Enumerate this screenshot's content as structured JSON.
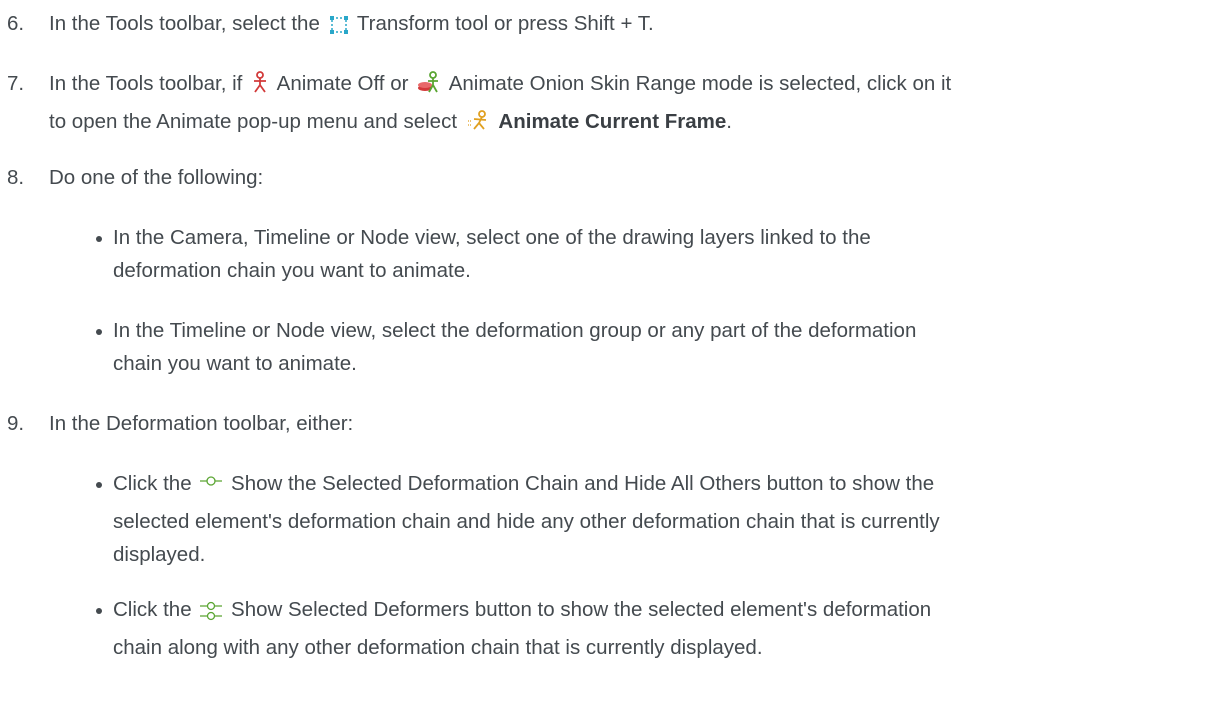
{
  "step6": {
    "num": "6.",
    "pre": "In the Tools toolbar, select the",
    "post": "Transform tool or press Shift + T."
  },
  "step7": {
    "num": "7.",
    "a": "In the Tools toolbar, if",
    "b": "Animate Off or",
    "c": "Animate Onion Skin Range mode is selected, click on it",
    "d": "to open the Animate pop-up menu and select",
    "bold": "Animate Current Frame",
    "end": "."
  },
  "step8": {
    "num": "8.",
    "text": "Do one of the following:",
    "bullet1_line1": "In the Camera, Timeline or Node view, select one of the drawing layers linked to the",
    "bullet1_line2": "deformation chain you want to animate.",
    "bullet2_line1": "In the Timeline or Node view, select the deformation group or any part of the deformation",
    "bullet2_line2": "chain you want to animate."
  },
  "step9": {
    "num": "9.",
    "text": "In the Deformation toolbar, either:",
    "bullet1_pre": "Click the",
    "bullet1_line1": "Show the Selected Deformation Chain and Hide All Others button to show the",
    "bullet1_line2": "selected element's deformation chain and hide any other deformation chain that is currently",
    "bullet1_line3": "displayed.",
    "bullet2_pre": "Click the",
    "bullet2_line1": "Show Selected Deformers button to show the selected element's deformation",
    "bullet2_line2": "chain along with any other deformation chain that is currently displayed."
  },
  "icons": {
    "transform": "transform-tool-icon",
    "animate_off": "animate-off-icon",
    "onion_skin": "animate-onion-skin-range-icon",
    "animate_current": "animate-current-frame-icon",
    "show_selected_chain": "show-selected-deformation-chain-icon",
    "show_selected_deformers": "show-selected-deformers-icon"
  },
  "colors": {
    "text": "#444a4f",
    "transform_icon": "#2aa7c9",
    "animate_red": "#d23a3a",
    "animate_green": "#5aa532",
    "animate_orange": "#e0a020"
  }
}
